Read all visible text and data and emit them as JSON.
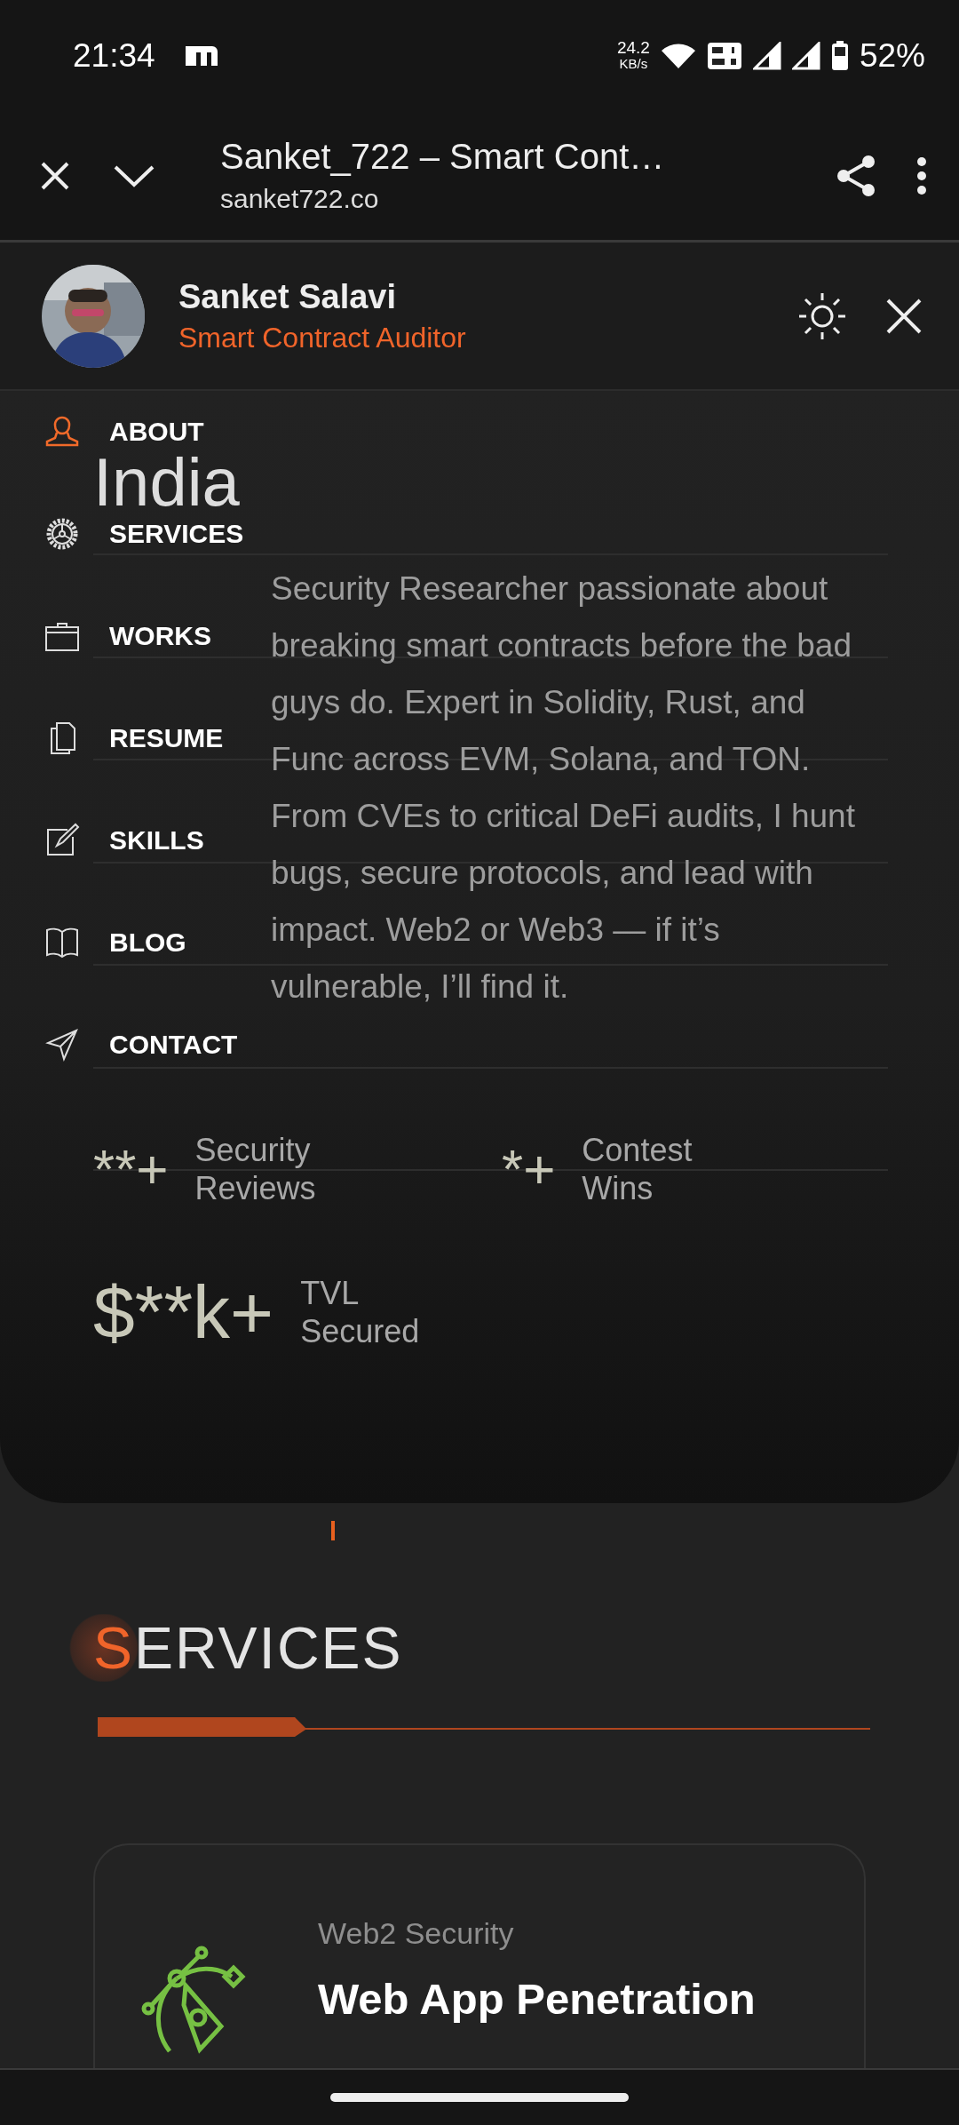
{
  "status_bar": {
    "time": "21:34",
    "net_speed": "24.2",
    "net_speed_unit": "KB/s",
    "battery": "52%"
  },
  "browser": {
    "title": "Sanket_722 – Smart Cont…",
    "url": "sanket722.co"
  },
  "site_header": {
    "name": "Sanket Salavi",
    "role": "Smart Contract Auditor"
  },
  "menu": [
    {
      "label": "ABOUT",
      "selected": true
    },
    {
      "label": "SERVICES",
      "selected": false
    },
    {
      "label": "WORKS",
      "selected": false
    },
    {
      "label": "RESUME",
      "selected": false
    },
    {
      "label": "SKILLS",
      "selected": false
    },
    {
      "label": "BLOG",
      "selected": false
    },
    {
      "label": "CONTACT",
      "selected": false
    }
  ],
  "hero": {
    "heading": "India",
    "bio": "Security Researcher passionate about breaking smart contracts before the bad guys do. Expert in Solidity, Rust, and Func across EVM, Solana, and TON. From CVEs to critical DeFi audits, I hunt bugs, secure protocols, and lead with impact. Web2 or Web3 — if it’s vulnerable, I’ll find it."
  },
  "stats": [
    {
      "value": "**+",
      "label": "Security Reviews"
    },
    {
      "value": "*+",
      "label": "Contest Wins"
    },
    {
      "value": "$**k+",
      "label": "TVL Secured"
    }
  ],
  "services_section": {
    "title": "SERVICES",
    "card": {
      "category": "Web2 Security",
      "title": "Web App Penetration"
    }
  }
}
